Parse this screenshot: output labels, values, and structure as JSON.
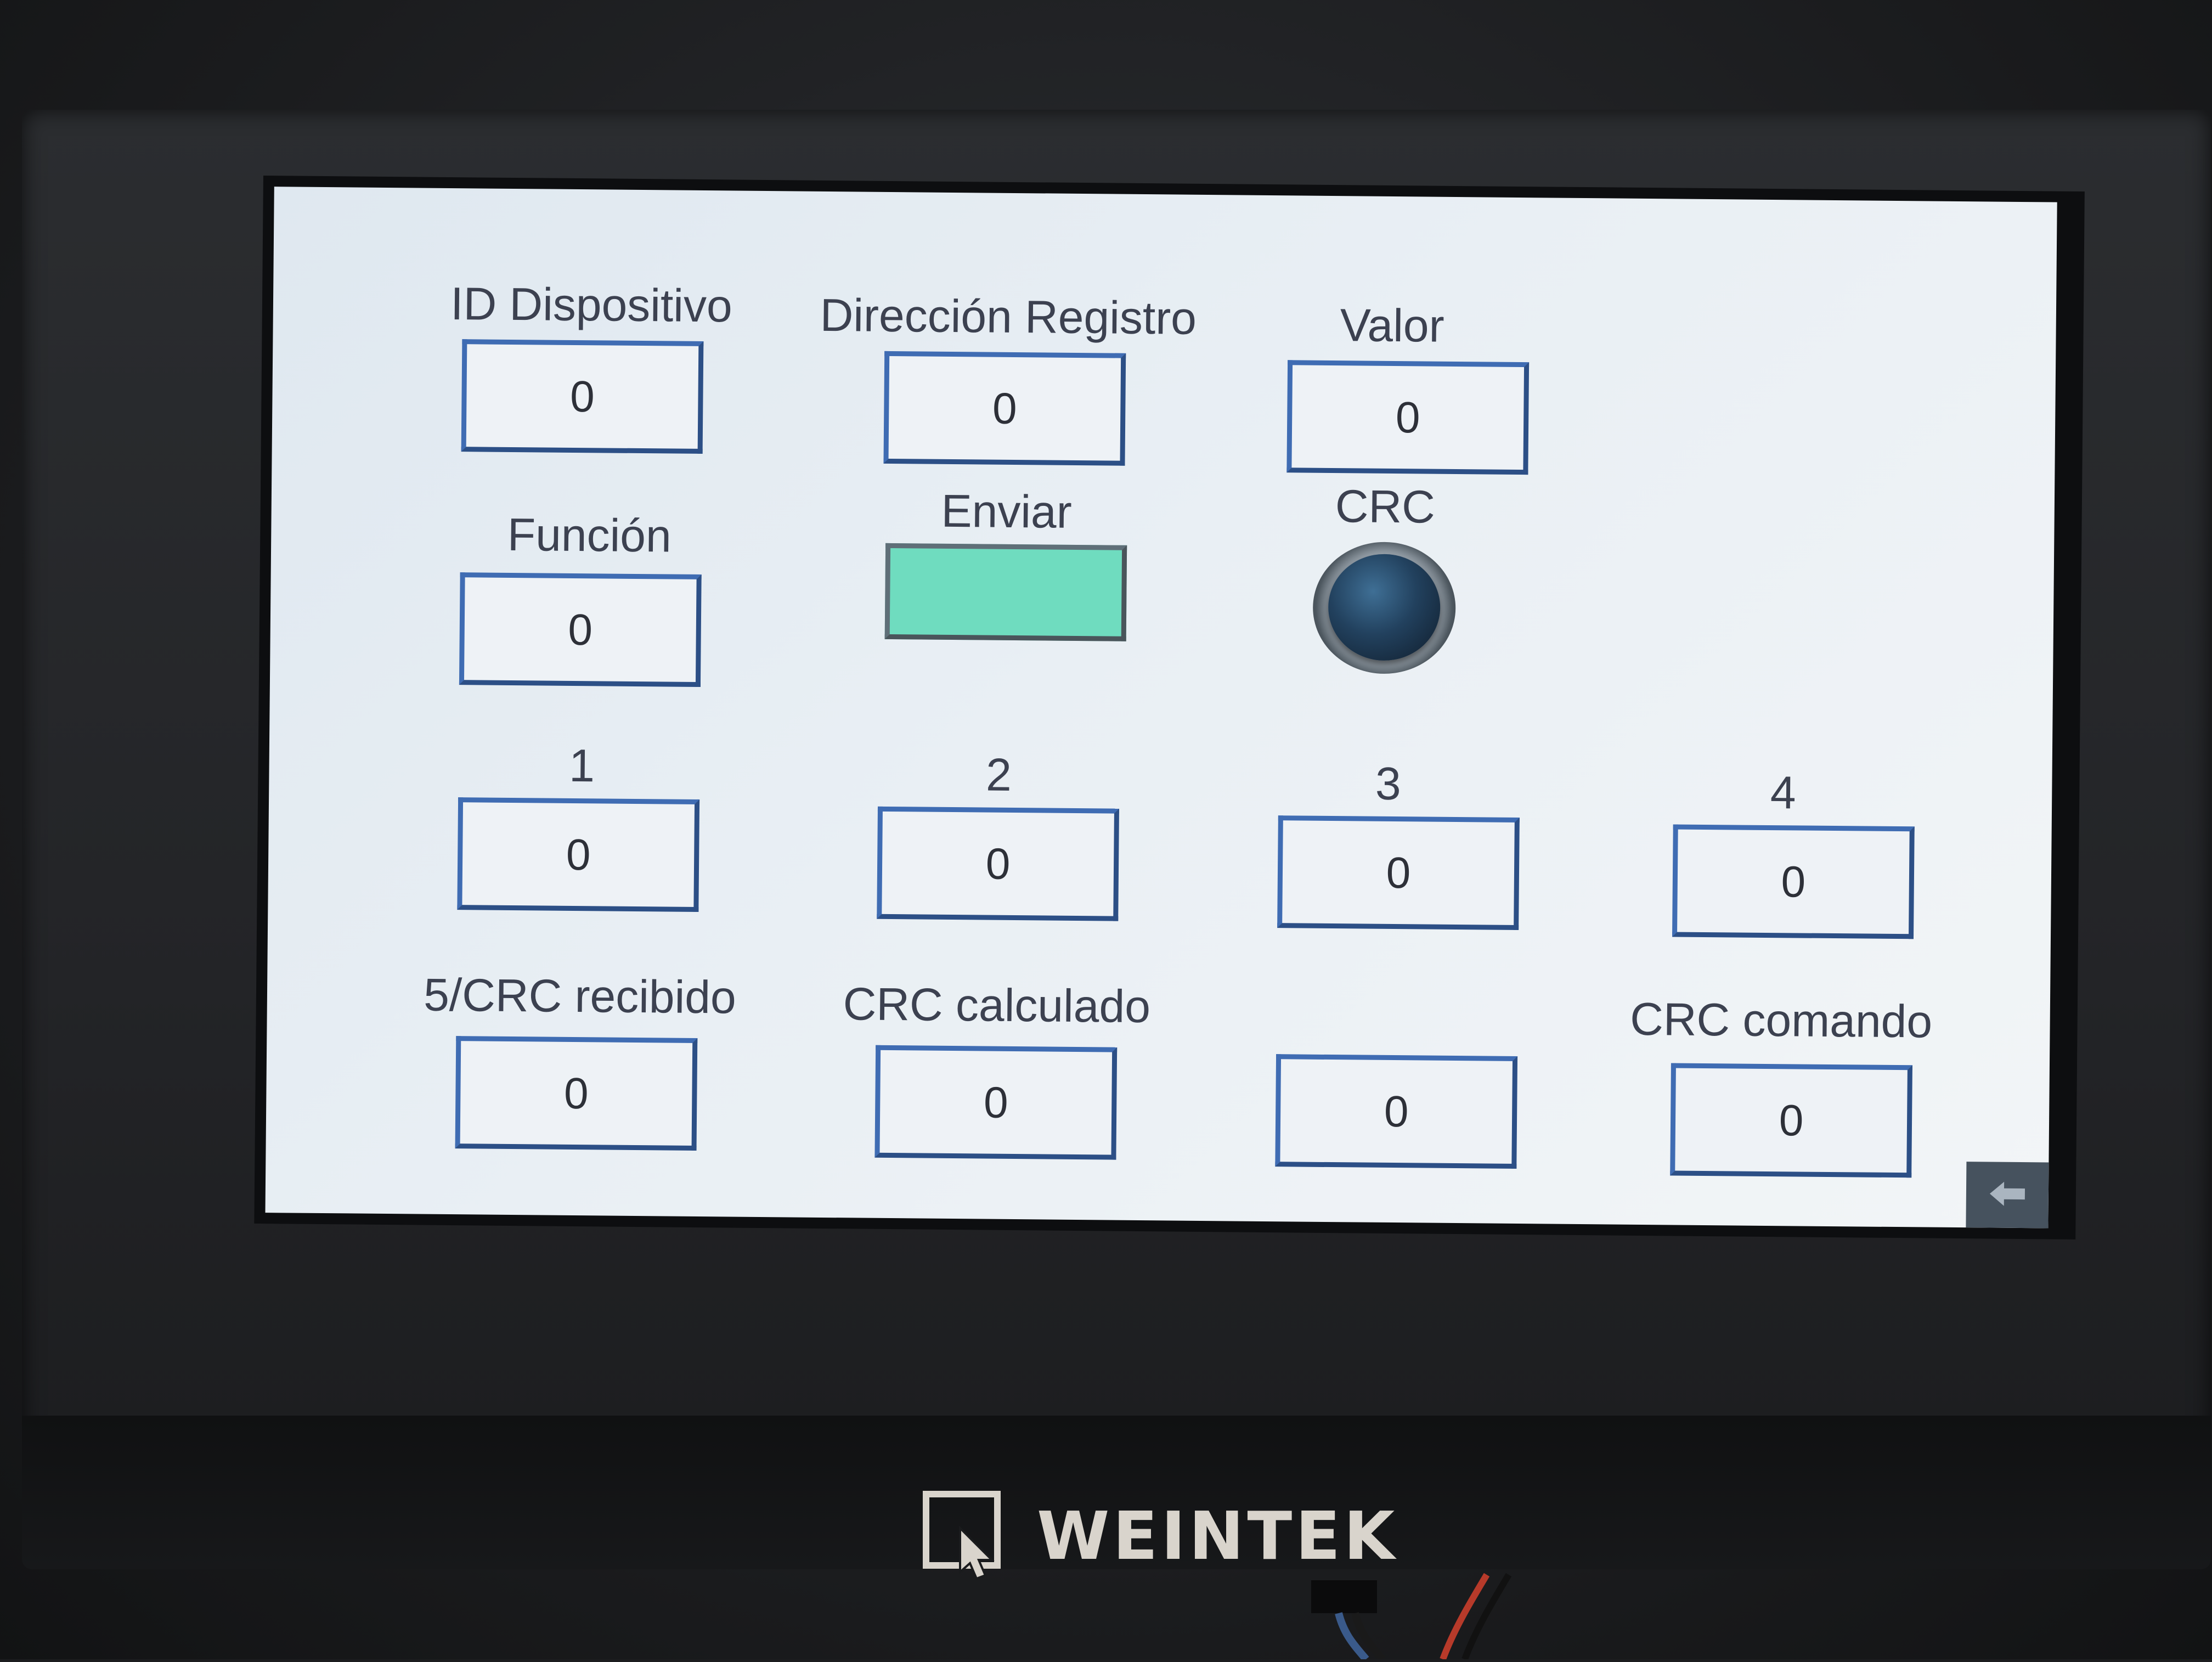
{
  "labels": {
    "device_id": "ID Dispositivo",
    "register_address": "Dirección Registro",
    "value": "Valor",
    "function": "Función",
    "send": "Enviar",
    "crc": "CRC",
    "byte_1": "1",
    "byte_2": "2",
    "byte_3": "3",
    "byte_4": "4",
    "crc_received": "5/CRC recibido",
    "crc_calculated": "CRC calculado",
    "crc_command": "CRC comando"
  },
  "values": {
    "device_id": "0",
    "register_address": "0",
    "value": "0",
    "function": "0",
    "byte_1": "0",
    "byte_2": "0",
    "byte_3": "0",
    "byte_4": "0",
    "crc_received": "0",
    "crc_calculated": "0",
    "unlabeled_row4_col3": "0",
    "crc_command": "0"
  },
  "brand": {
    "name": "WEINTEK"
  },
  "colors": {
    "send_button": "#6fdcbf",
    "field_border": "#3f6cb3",
    "crc_lamp": "#22415e",
    "screen_background": "#e9eff4"
  },
  "icons": {
    "back": "back-arrow-icon",
    "brand_mark": "weintek-logo-icon",
    "crc_indicator": "indicator-lamp-icon"
  }
}
